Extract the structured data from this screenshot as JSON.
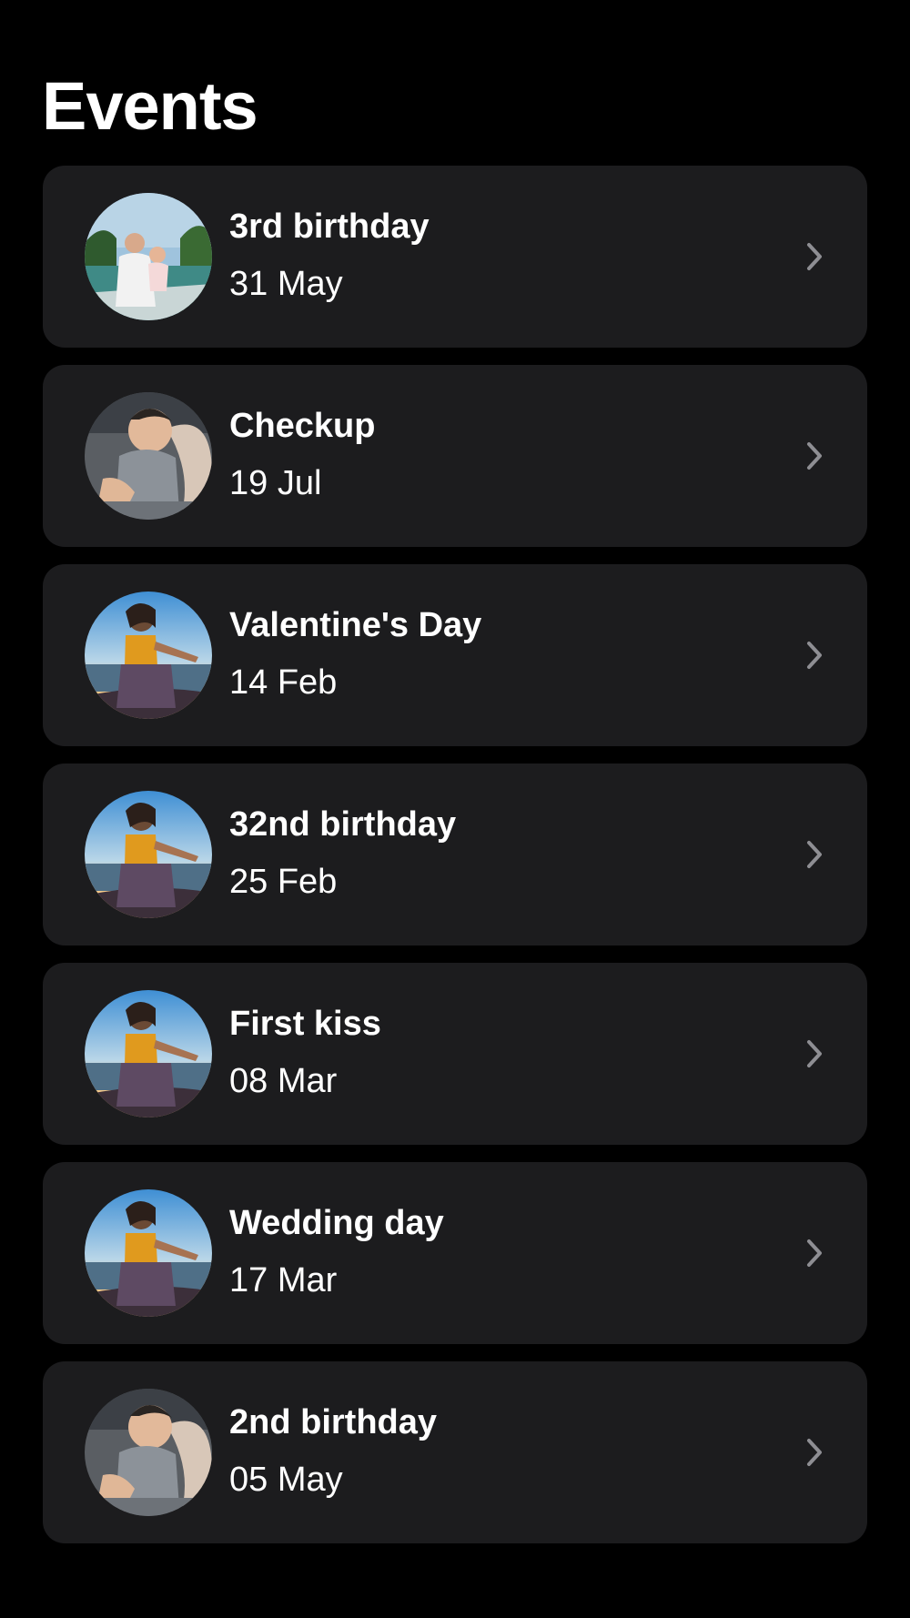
{
  "header": {
    "title": "Events"
  },
  "events": [
    {
      "title": "3rd birthday",
      "date": "31 May",
      "photo": "tropical-boat-photo"
    },
    {
      "title": "Checkup",
      "date": "19 Jul",
      "photo": "sleeping-baby-photo"
    },
    {
      "title": "Valentine's Day",
      "date": "14 Feb",
      "photo": "sunset-woman-photo"
    },
    {
      "title": "32nd birthday",
      "date": "25 Feb",
      "photo": "sunset-woman-photo"
    },
    {
      "title": "First kiss",
      "date": "08 Mar",
      "photo": "sunset-woman-photo"
    },
    {
      "title": "Wedding day",
      "date": "17 Mar",
      "photo": "sunset-woman-photo"
    },
    {
      "title": "2nd birthday",
      "date": "05 May",
      "photo": "sleeping-baby-photo"
    }
  ],
  "icons": {
    "row_chevron": "chevron-right-icon"
  },
  "colors": {
    "background": "#000000",
    "card": "#1c1c1e",
    "text": "#ffffff",
    "chevron": "#8e8e93"
  }
}
